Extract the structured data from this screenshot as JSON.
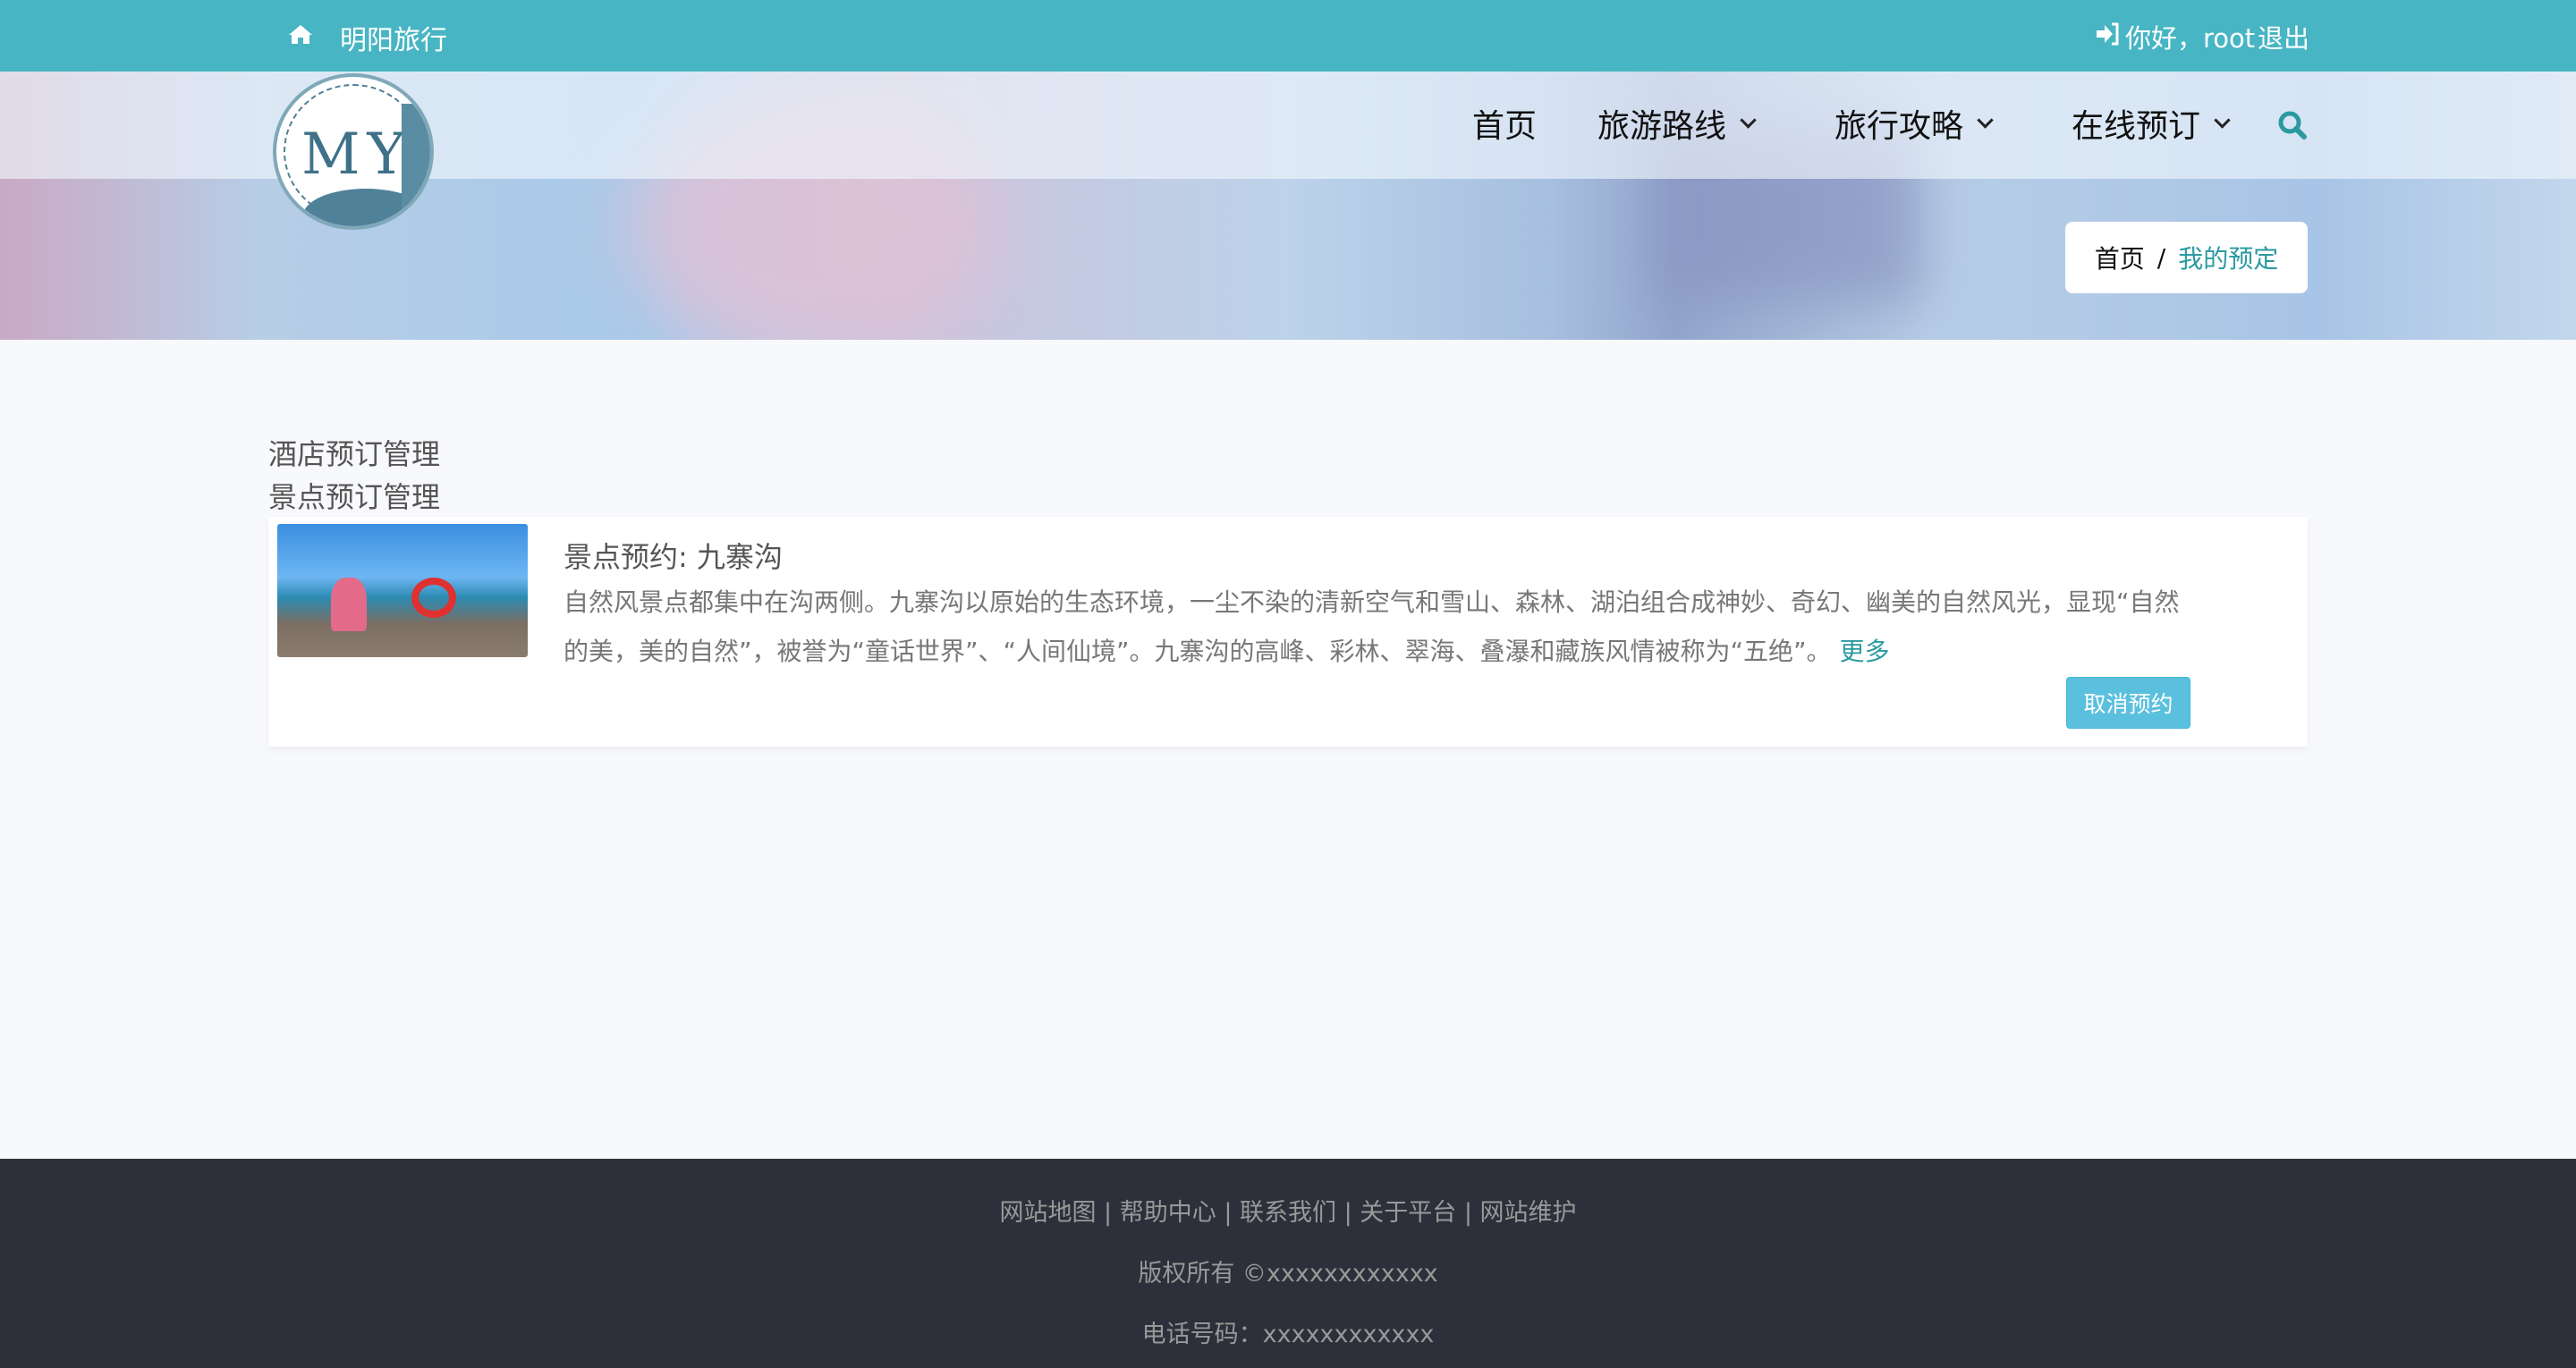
{
  "topbar": {
    "brand": "明阳旅行",
    "greeting": "你好，root",
    "logout": "退出"
  },
  "logo": {
    "text": "MY"
  },
  "nav": {
    "items": [
      {
        "label": "首页"
      },
      {
        "label": "旅游路线"
      },
      {
        "label": "旅行攻略"
      },
      {
        "label": "在线预订"
      }
    ]
  },
  "breadcrumb": {
    "home": "首页",
    "sep": "/",
    "current": "我的预定"
  },
  "sidebar": {
    "links": [
      "酒店预订管理",
      "景点预订管理"
    ]
  },
  "booking": {
    "title": "景点预约: 九寨沟",
    "desc_line1": "自然风景点都集中在沟两侧。九寨沟以原始的生态环境，一尘不染的清新空气和雪山、森林、湖泊组合成神妙、奇幻、幽美的自然风光，显现“自然",
    "desc_line2": "的美，美的自然”，被誉为“童话世界”、“人间仙境”。九寨沟的高峰、彩林、翠海、叠瀑和藏族风情被称为“五绝”。",
    "more": "更多",
    "cancel": "取消预约"
  },
  "footer": {
    "links": "网站地图 | 帮助中心 | 联系我们 | 关于平台 | 网站维护",
    "copyright": "版权所有 ©xxxxxxxxxxxx",
    "phone": "电话号码：xxxxxxxxxxxx"
  },
  "colors": {
    "primary": "#47b5c3",
    "accent": "#2a9aa0",
    "button": "#5bc0de",
    "footer": "#2d2f3a"
  }
}
